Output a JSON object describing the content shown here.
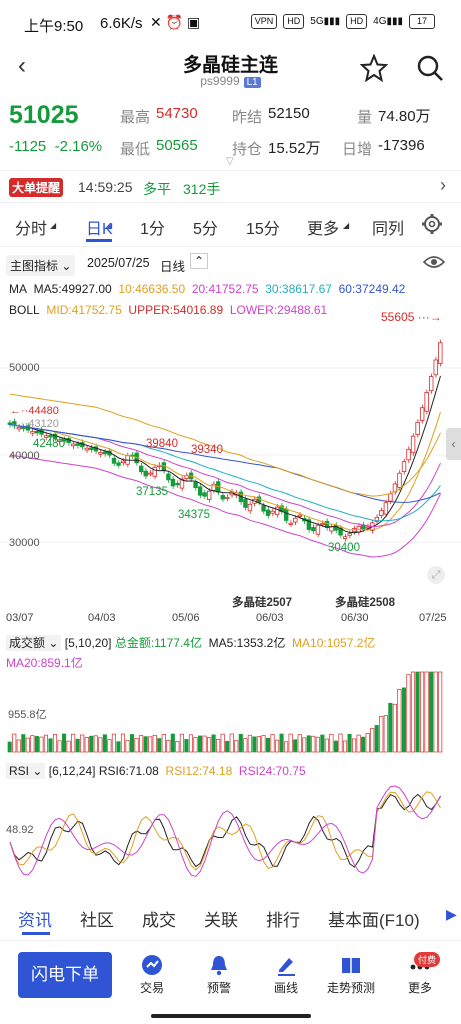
{
  "status": {
    "time": "上午9:50",
    "speed": "6.6K/s",
    "battery": "17"
  },
  "nav": {
    "title": "多晶硅主连",
    "code": "ps9999",
    "badge": "L1"
  },
  "quote": {
    "price": "51025",
    "change": "-1125",
    "pct": "-2.16%",
    "high_label": "最高",
    "high": "54730",
    "low_label": "最低",
    "low": "50565",
    "prev_label": "昨结",
    "prev": "52150",
    "oi_label": "持仓",
    "oi": "15.52万",
    "vol_label": "量",
    "vol": "74.80万",
    "day_label": "日增",
    "day": "-17396"
  },
  "alert": {
    "badge": "大单提醒",
    "time": "14:59:25",
    "kind": "多平",
    "qty": "312手"
  },
  "tabs": [
    "分时",
    "日K",
    "1分",
    "5分",
    "15分",
    "更多",
    "同列"
  ],
  "indicator": {
    "menu": "主图指标",
    "date": "2025/07/25",
    "period": "日线"
  },
  "ma": {
    "label": "MA",
    "ma5": "MA5:49927.00",
    "ma10": "10:46636.50",
    "ma20": "20:41752.75",
    "ma30": "30:38617.67",
    "ma60": "60:37249.42"
  },
  "boll": {
    "label": "BOLL",
    "mid": "MID:41752.75",
    "upper": "UPPER:54016.89",
    "lower": "LOWER:29488.61"
  },
  "price_axis": [
    "50000",
    "40000",
    "30000"
  ],
  "annotations": {
    "hi": "55605",
    "a": "44480",
    "b": "43120",
    "c": "42480",
    "d": "39840",
    "e": "39340",
    "f": "37135",
    "g": "34375",
    "h": "30400"
  },
  "contracts": [
    "多晶硅2507",
    "多晶硅2508"
  ],
  "dates": [
    "03/07",
    "04/03",
    "05/06",
    "06/03",
    "06/30",
    "07/25"
  ],
  "volume": {
    "menu": "成交额",
    "params": "[5,10,20]",
    "total": "总金额:1177.4亿",
    "ma5": "MA5:1353.2亿",
    "ma10": "MA10:1057.2亿",
    "ma20": "MA20:859.1亿",
    "axis": "955.8亿"
  },
  "rsi": {
    "menu": "RSI",
    "params": "[6,12,24]",
    "r6": "RSI6:71.08",
    "r12": "RSI12:74.18",
    "r24": "RSI24:70.75",
    "axis": "48.92"
  },
  "bottom_tabs": [
    "资讯",
    "社区",
    "成交",
    "关联",
    "排行",
    "基本面(F10)"
  ],
  "toolbar": {
    "flash": "闪电下单",
    "trade": "交易",
    "warn": "预警",
    "draw": "画线",
    "trend": "走势预测",
    "more": "更多",
    "badge": "付费"
  },
  "colors": {
    "up": "#d52b2b",
    "down": "#169b3c",
    "ma5": "#222",
    "ma10": "#e0a020",
    "ma20": "#cc44cc",
    "ma30": "#20b0c0",
    "ma60": "#3355cc"
  }
}
